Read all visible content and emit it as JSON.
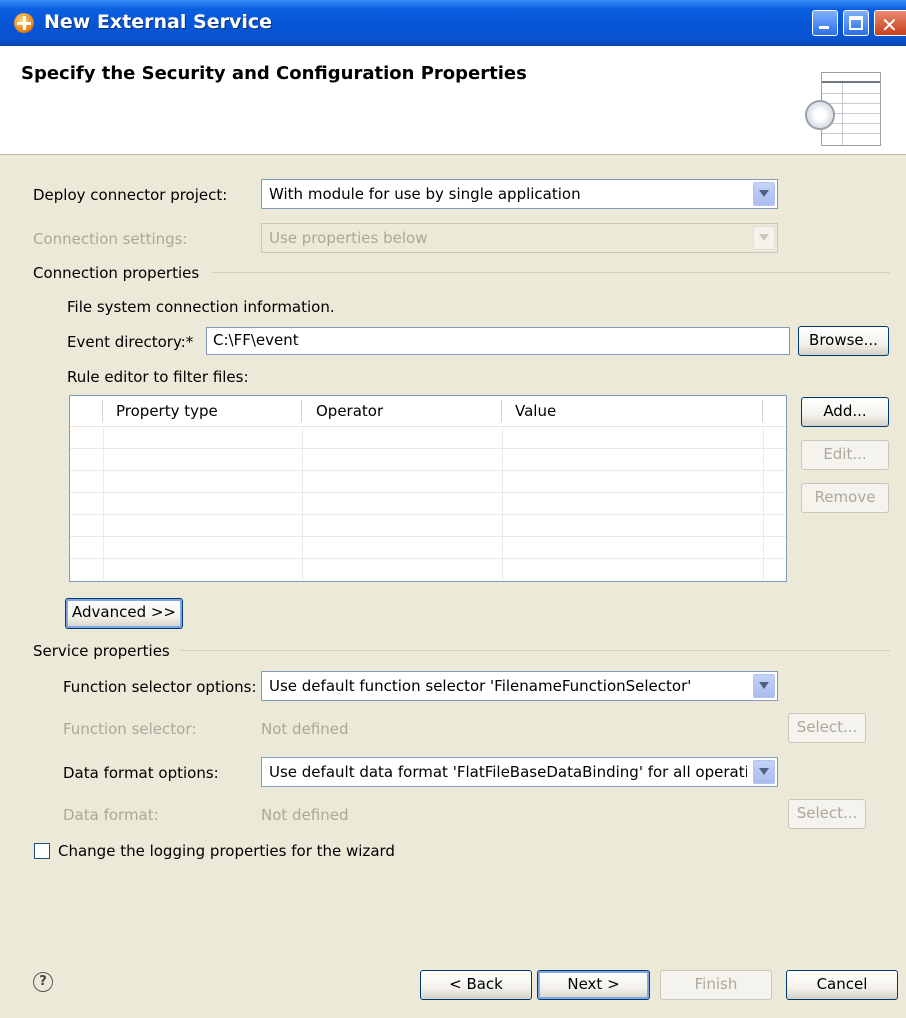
{
  "window": {
    "title": "New External Service"
  },
  "banner": {
    "title": "Specify the Security and Configuration Properties"
  },
  "deploy": {
    "label": "Deploy connector project:",
    "value": "With module for use by single application"
  },
  "connection_settings": {
    "label": "Connection settings:",
    "value": "Use properties below"
  },
  "connection_properties": {
    "group_label": "Connection properties",
    "info": "File system connection information.",
    "event_directory_label": "Event directory:*",
    "event_directory_value": "C:\\FF\\event",
    "browse_label": "Browse...",
    "rule_editor_label": "Rule editor to filter files:",
    "table": {
      "columns": [
        "Property type",
        "Operator",
        "Value"
      ],
      "rows": []
    },
    "add_label": "Add...",
    "edit_label": "Edit...",
    "remove_label": "Remove",
    "advanced_label": "Advanced >>"
  },
  "service_properties": {
    "group_label": "Service properties",
    "function_selector_options_label": "Function selector options:",
    "function_selector_options_value": "Use default function selector 'FilenameFunctionSelector'",
    "function_selector_label": "Function selector:",
    "function_selector_value": "Not defined",
    "select_label": "Select...",
    "data_format_options_label": "Data format options:",
    "data_format_options_value": "Use default data format 'FlatFileBaseDataBinding' for all operatior",
    "data_format_label": "Data format:",
    "data_format_value": "Not defined",
    "select2_label": "Select..."
  },
  "logging": {
    "label": "Change the logging properties for the wizard",
    "checked": false
  },
  "footer": {
    "help_glyph": "?",
    "back_label": "< Back",
    "next_label": "Next >",
    "finish_label": "Finish",
    "cancel_label": "Cancel"
  }
}
